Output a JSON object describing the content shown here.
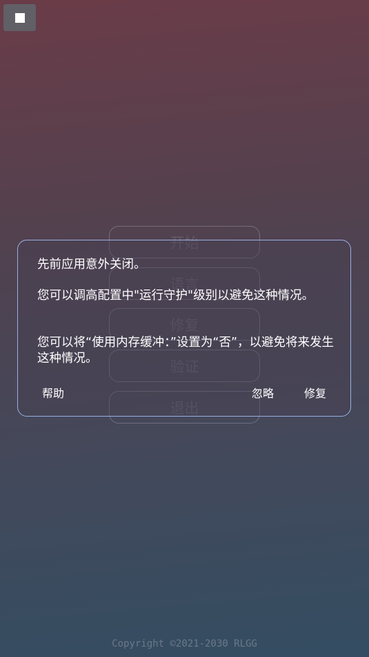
{
  "toolbar": {
    "stop_icon": "stop-icon"
  },
  "menu": {
    "buttons": [
      "开始",
      "语言",
      "修复",
      "验证",
      "退出"
    ]
  },
  "dialog": {
    "line1": "先前应用意外关闭。",
    "line2": "您可以调高配置中\"运行守护\"级别以避免这种情况。",
    "line3": "您可以将“使用内存缓冲：”设置为“否”，以避免将来发生这种情况。",
    "help_label": "帮助",
    "ignore_label": "忽略",
    "repair_label": "修复"
  },
  "footer": {
    "copyright": "Copyright ©2021-2030 RLGG"
  }
}
